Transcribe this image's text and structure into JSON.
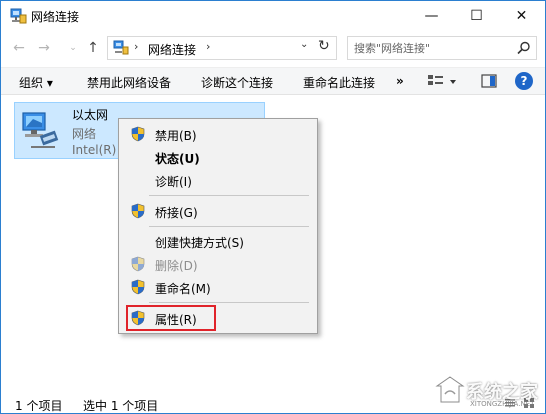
{
  "window": {
    "title": "网络连接"
  },
  "window_controls": {
    "minimize": "—",
    "maximize": "☐",
    "close": "✕"
  },
  "nav": {
    "back": "←",
    "forward": "→",
    "recent": "⌄",
    "up": "↑",
    "address_sep": "›",
    "address_path": "网络连接",
    "address_sep2": "›",
    "address_dropdown": "⌄",
    "refresh": "↻",
    "search_placeholder": "搜索\"网络连接\""
  },
  "toolbar": {
    "organize": "组织 ▾",
    "disable_device": "禁用此网络设备",
    "diagnose": "诊断这个连接",
    "rename": "重命名此连接",
    "more": "»",
    "help": "?"
  },
  "connection": {
    "name": "以太网",
    "type": "网络",
    "device": "Intel(R) 8"
  },
  "context_menu": {
    "items": [
      {
        "label": "禁用(B)",
        "shield": true,
        "bold": false,
        "disabled": false
      },
      {
        "label": "状态(U)",
        "shield": false,
        "bold": true,
        "disabled": false
      },
      {
        "label": "诊断(I)",
        "shield": false,
        "bold": false,
        "disabled": false
      },
      {
        "label": "桥接(G)",
        "shield": true,
        "bold": false,
        "disabled": false
      },
      {
        "label": "创建快捷方式(S)",
        "shield": false,
        "bold": false,
        "disabled": false
      },
      {
        "label": "删除(D)",
        "shield": true,
        "bold": false,
        "disabled": true
      },
      {
        "label": "重命名(M)",
        "shield": true,
        "bold": false,
        "disabled": false
      },
      {
        "label": "属性(R)",
        "shield": true,
        "bold": false,
        "disabled": false
      }
    ]
  },
  "status": {
    "count": "1 个项目",
    "selected": "选中 1 个项目"
  },
  "watermark": {
    "text": "系统之家",
    "sub": "XITONGZHIJIA.NET"
  },
  "colors": {
    "selection_bg": "#cce8ff",
    "highlight_box": "#e0232a",
    "help_blue": "#1f66c8"
  }
}
